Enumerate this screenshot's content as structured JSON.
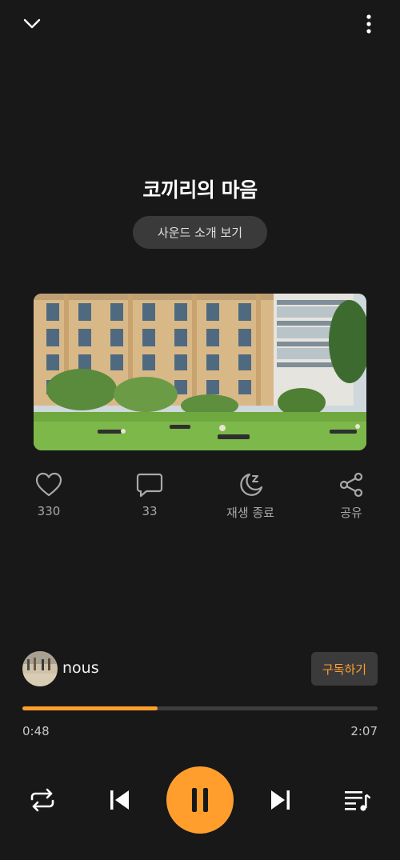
{
  "header": {
    "collapse_icon": "chevron-down-icon",
    "menu_icon": "more-vertical-icon"
  },
  "track": {
    "title": "코끼리의 마음",
    "intro_button_label": "사운드 소개 보기",
    "artwork": "park-lawn-photo"
  },
  "actions": [
    {
      "icon": "heart-icon",
      "label": "330"
    },
    {
      "icon": "comment-icon",
      "label": "33"
    },
    {
      "icon": "sleep-timer-icon",
      "label": "재생 종료"
    },
    {
      "icon": "share-icon",
      "label": "공유"
    }
  ],
  "creator": {
    "name": "nous",
    "subscribe_label": "구독하기"
  },
  "progress": {
    "current": "0:48",
    "total": "2:07",
    "fraction": 0.38
  },
  "controls": {
    "repeat_icon": "repeat-icon",
    "prev_icon": "skip-previous-icon",
    "play_icon": "pause-icon",
    "next_icon": "skip-next-icon",
    "queue_icon": "playlist-icon"
  },
  "colors": {
    "background": "#181818",
    "accent": "#ff9e2c",
    "secondary_text": "#a9a9a9",
    "button_bg": "#3a3a3a"
  }
}
